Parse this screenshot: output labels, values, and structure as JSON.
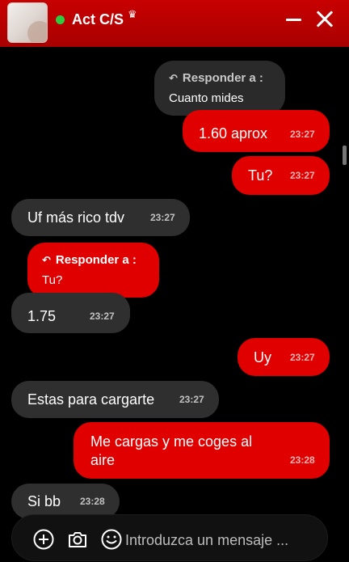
{
  "header": {
    "contact_name": "Act C/S",
    "crown_icon": "crown-icon",
    "status_color": "#2ecc40",
    "brand_color": "#c80000"
  },
  "reply_label": "Responder a :",
  "messages": [
    {
      "side": "out",
      "type": "reply",
      "quote": "Cuanto mides"
    },
    {
      "side": "out",
      "text": "1.60 aprox",
      "time": "23:27"
    },
    {
      "side": "out",
      "text": "Tu?",
      "time": "23:27"
    },
    {
      "side": "in",
      "text": "Uf más rico tdv",
      "time": "23:27"
    },
    {
      "side": "in",
      "type": "reply",
      "quote": "Tu?"
    },
    {
      "side": "in",
      "text": "1.75",
      "time": "23:27"
    },
    {
      "side": "out",
      "text": "Uy",
      "time": "23:27"
    },
    {
      "side": "in",
      "text": "Estas para cargarte",
      "time": "23:27"
    },
    {
      "side": "out",
      "text_lines": [
        "Me cargas y me coges al",
        "aire"
      ],
      "time": "23:28"
    },
    {
      "side": "in",
      "text": "Si bb",
      "time": "23:28"
    }
  ],
  "composer": {
    "placeholder": "Introduzca un mensaje ...",
    "icons": [
      "add-icon",
      "camera-icon",
      "emoji-icon"
    ]
  }
}
